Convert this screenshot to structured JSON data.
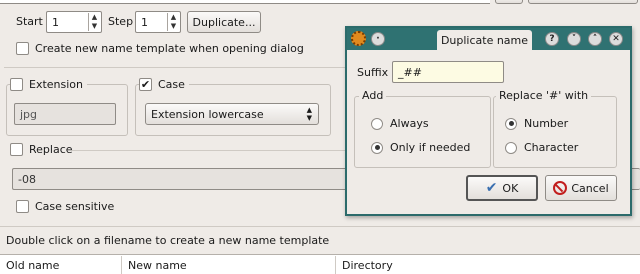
{
  "main": {
    "start_label": "Start",
    "start_value": "1",
    "step_label": "Step",
    "step_value": "1",
    "duplicate_button": "Duplicate...",
    "create_template_label": "Create new name template when opening dialog",
    "extension_label": "Extension",
    "extension_value": "jpg",
    "case_label": "Case",
    "case_selected": "Extension lowercase",
    "replace_label": "Replace",
    "replace_value": "-08",
    "case_sensitive_label": "Case sensitive",
    "hint_text": "Double click on a filename to create a new name template",
    "columns": [
      "Old name",
      "New name",
      "Directory"
    ]
  },
  "dialog": {
    "title": "Duplicate name",
    "suffix_label": "Suffix",
    "suffix_value": "_##",
    "add_title": "Add",
    "add_options": [
      "Always",
      "Only if needed"
    ],
    "replace_title": "Replace '#' with",
    "replace_options": [
      "Number",
      "Character"
    ],
    "ok_label": "OK",
    "cancel_label": "Cancel"
  },
  "icons": {
    "app_icon": "gear-icon",
    "help": "help-icon",
    "collapse": "chevron-down-icon",
    "maximize": "chevron-up-icon",
    "close": "close-icon",
    "ok": "checkmark-icon",
    "cancel": "forbidden-icon"
  }
}
